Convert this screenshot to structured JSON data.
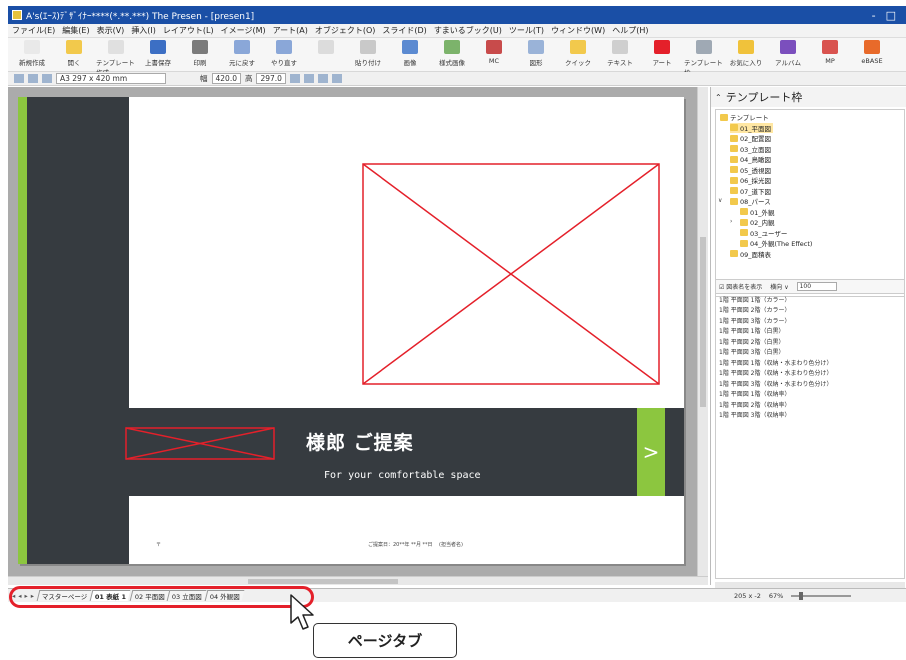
{
  "window": {
    "title": "A's(ｴｰｽ)ﾃﾞｻﾞｲﾅｰ****(*.**.***)  The Presen - [presen1]",
    "controls": [
      "-",
      "□"
    ]
  },
  "menu": [
    "ファイル(E)",
    "編集(E)",
    "表示(V)",
    "挿入(I)",
    "レイアウト(L)",
    "イメージ(M)",
    "アート(A)",
    "オブジェクト(O)",
    "スライド(D)",
    "すまいるブック(U)",
    "ツール(T)",
    "ウィンドウ(W)",
    "ヘルプ(H)"
  ],
  "ribbon": [
    {
      "label": "新規作成",
      "color": "#e9e9e9"
    },
    {
      "label": "開く",
      "color": "#f2c94c"
    },
    {
      "label": "テンプレート作成",
      "color": "#e0e0e0"
    },
    {
      "label": "上書保存",
      "color": "#3c6fc4"
    },
    {
      "label": "印刷",
      "color": "#7b7b7b"
    },
    {
      "label": "元に戻す",
      "color": "#8aa7d8"
    },
    {
      "label": "やり直す",
      "color": "#8aa7d8"
    },
    {
      "label": "",
      "color": "#dcdcdc"
    },
    {
      "label": "貼り付け",
      "color": "#c9c9c9"
    },
    {
      "label": "画像",
      "color": "#5b8ad1"
    },
    {
      "label": "様式画像",
      "color": "#7cb36b"
    },
    {
      "label": "MC",
      "color": "#c84b4b"
    },
    {
      "label": "図形",
      "color": "#9ab3d8"
    },
    {
      "label": "クイック",
      "color": "#f2c94c"
    },
    {
      "label": "テキスト",
      "color": "#cfcfcf"
    },
    {
      "label": "アート",
      "color": "#e4202a"
    },
    {
      "label": "テンプレート枠",
      "color": "#9fa9b4"
    },
    {
      "label": "お気に入り",
      "color": "#f0c23b"
    },
    {
      "label": "アルバム",
      "color": "#7b4fbd"
    },
    {
      "label": "MP",
      "color": "#d9534f"
    },
    {
      "label": "eBASE",
      "color": "#e86a2a"
    }
  ],
  "toolbar2": {
    "paper": "A3 297 x 420 mm",
    "width_label": "幅",
    "width_value": "420.0",
    "height_label": "高",
    "height_value": "297.0"
  },
  "slide": {
    "title": "様郎 ご提案",
    "subtitle": "For your comfortable space",
    "arrow": ">",
    "footer_left": "〒",
    "footer_date": "ご提案日：20**年 **月 **日",
    "footer_staff": "(担当者名)"
  },
  "template_panel": {
    "header": "テンプレート枠",
    "tree": [
      {
        "label": "テンプレート",
        "level": 0
      },
      {
        "label": "01_平面図",
        "level": 1,
        "selected": true
      },
      {
        "label": "02_配置図",
        "level": 1
      },
      {
        "label": "03_立面図",
        "level": 1
      },
      {
        "label": "04_鳥瞰図",
        "level": 1
      },
      {
        "label": "05_透視図",
        "level": 1
      },
      {
        "label": "06_採光図",
        "level": 1
      },
      {
        "label": "07_道下図",
        "level": 1
      },
      {
        "label": "08_パース",
        "level": 1,
        "expanded": true
      },
      {
        "label": "01_外観",
        "level": 2
      },
      {
        "label": "02_内観",
        "level": 2,
        "collapsed": true
      },
      {
        "label": "03_ユーザー",
        "level": 2
      },
      {
        "label": "04_外観(The Effect)",
        "level": 2
      },
      {
        "label": "09_面積表",
        "level": 1
      }
    ],
    "list_header": {
      "checkbox_label": "☑ 図表名を表示",
      "sort_label": "横向 ∨",
      "size_value": "100"
    },
    "list": [
      "1階 平面図 1階（カラー）",
      "1階 平面図 2階（カラー）",
      "1階 平面図 3階（カラー）",
      "1階 平面図 1階（白黒）",
      "1階 平面図 2階（白黒）",
      "1階 平面図 3階（白黒）",
      "1階 平面図 1階（収納・水まわり色分け）",
      "1階 平面図 2階（収納・水まわり色分け）",
      "1階 平面図 3階（収納・水まわり色分け）",
      "1階 平面図 1階（収納率）",
      "1階 平面図 2階（収納率）",
      "1階 平面図 3階（収納率）"
    ]
  },
  "tabs": {
    "nav": [
      "◂",
      "◂",
      "▸",
      "▸"
    ],
    "items": [
      {
        "label": "マスターページ",
        "active": false
      },
      {
        "label": "01 表紙 1",
        "active": true
      },
      {
        "label": "02 平面図",
        "active": false
      },
      {
        "label": "03 立面図",
        "active": false
      },
      {
        "label": "04 外観図",
        "active": false
      }
    ]
  },
  "status": {
    "coords": "205 x -2",
    "zoom": "67%"
  },
  "callout": {
    "label": "ページタブ"
  },
  "colors": {
    "accent_green": "#8cc63f",
    "slide_dark": "#363b40",
    "placeholder_red": "#e4202a",
    "highlight_red": "#e4202a",
    "titlebar_blue": "#1a4fa6"
  }
}
